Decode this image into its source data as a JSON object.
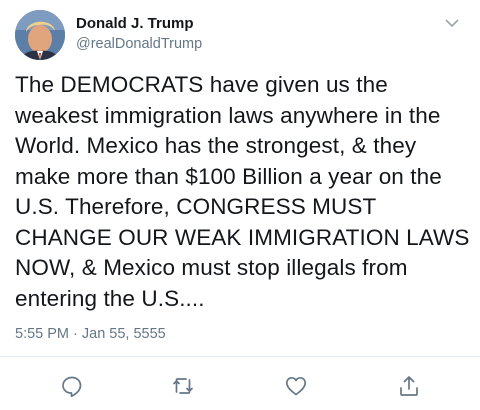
{
  "tweet": {
    "author": {
      "display_name": "Donald J. Trump",
      "handle": "@realDonaldTrump",
      "avatar_icon": "profile-photo"
    },
    "text": "The DEMOCRATS have given us the weakest immigration laws anywhere in the World. Mexico has the strongest, & they make more than $100 Billion a year on the U.S. Therefore, CONGRESS MUST CHANGE OUR WEAK IMMIGRATION LAWS NOW, & Mexico must stop illegals from entering the U.S....",
    "timestamp": "5:55 PM · Jan 55, 5555",
    "menu_icon": "chevron-down-icon",
    "actions": [
      {
        "name": "reply",
        "icon": "reply-icon"
      },
      {
        "name": "retweet",
        "icon": "retweet-icon"
      },
      {
        "name": "like",
        "icon": "heart-icon"
      },
      {
        "name": "share",
        "icon": "share-icon"
      }
    ]
  },
  "colors": {
    "text_primary": "#14171a",
    "text_secondary": "#657786",
    "icon_gray": "#657786",
    "divider": "#e6ecf0",
    "background": "#ffffff"
  }
}
